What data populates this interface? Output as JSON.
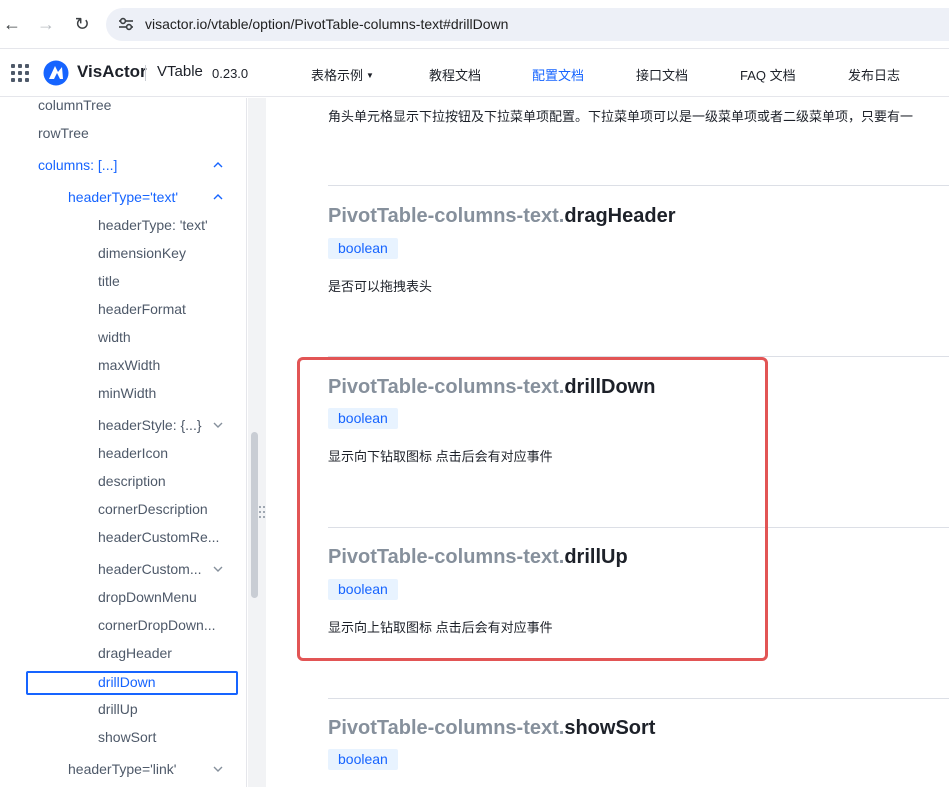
{
  "browser": {
    "url": "visactor.io/vtable/option/PivotTable-columns-text#drillDown"
  },
  "header": {
    "brand": "VisActor",
    "product": "VTable",
    "version": "0.23.0",
    "nav": [
      {
        "label": "表格示例",
        "has_caret": true
      },
      {
        "label": "教程文档"
      },
      {
        "label": "配置文档",
        "active": true
      },
      {
        "label": "接口文档"
      },
      {
        "label": "FAQ 文档"
      },
      {
        "label": "发布日志"
      }
    ]
  },
  "sidebar": {
    "items": [
      {
        "label": "columnTree"
      },
      {
        "label": "rowTree"
      },
      {
        "label": "columns: [...]",
        "expanded": true
      },
      {
        "label": "headerType='text'",
        "expanded": true
      },
      {
        "label": "headerType: 'text'"
      },
      {
        "label": "dimensionKey"
      },
      {
        "label": "title"
      },
      {
        "label": "headerFormat"
      },
      {
        "label": "width"
      },
      {
        "label": "maxWidth"
      },
      {
        "label": "minWidth"
      },
      {
        "label": "headerStyle: {...}",
        "collapsed": true
      },
      {
        "label": "headerIcon"
      },
      {
        "label": "description"
      },
      {
        "label": "cornerDescription"
      },
      {
        "label": "headerCustomRe..."
      },
      {
        "label": "headerCustom...",
        "collapsed": true
      },
      {
        "label": "dropDownMenu"
      },
      {
        "label": "cornerDropDown..."
      },
      {
        "label": "dragHeader"
      },
      {
        "label": "drillDown",
        "selected": true
      },
      {
        "label": "drillUp"
      },
      {
        "label": "showSort"
      },
      {
        "label": "headerType='link'",
        "collapsed": true
      }
    ]
  },
  "main": {
    "intro_text": "角头单元格显示下拉按钮及下拉菜单项配置。下拉菜单项可以是一级菜单项或者二级菜单项，只要有一",
    "prefix": "PivotTable-columns-text.",
    "sections": [
      {
        "name": "dragHeader",
        "type": "boolean",
        "description": "是否可以拖拽表头"
      },
      {
        "name": "drillDown",
        "type": "boolean",
        "description": "显示向下钻取图标 点击后会有对应事件"
      },
      {
        "name": "drillUp",
        "type": "boolean",
        "description": "显示向上钻取图标 点击后会有对应事件"
      },
      {
        "name": "showSort",
        "type": "boolean",
        "description": ""
      }
    ]
  },
  "colors": {
    "accent": "#1664ff",
    "highlight": "#e25555"
  }
}
